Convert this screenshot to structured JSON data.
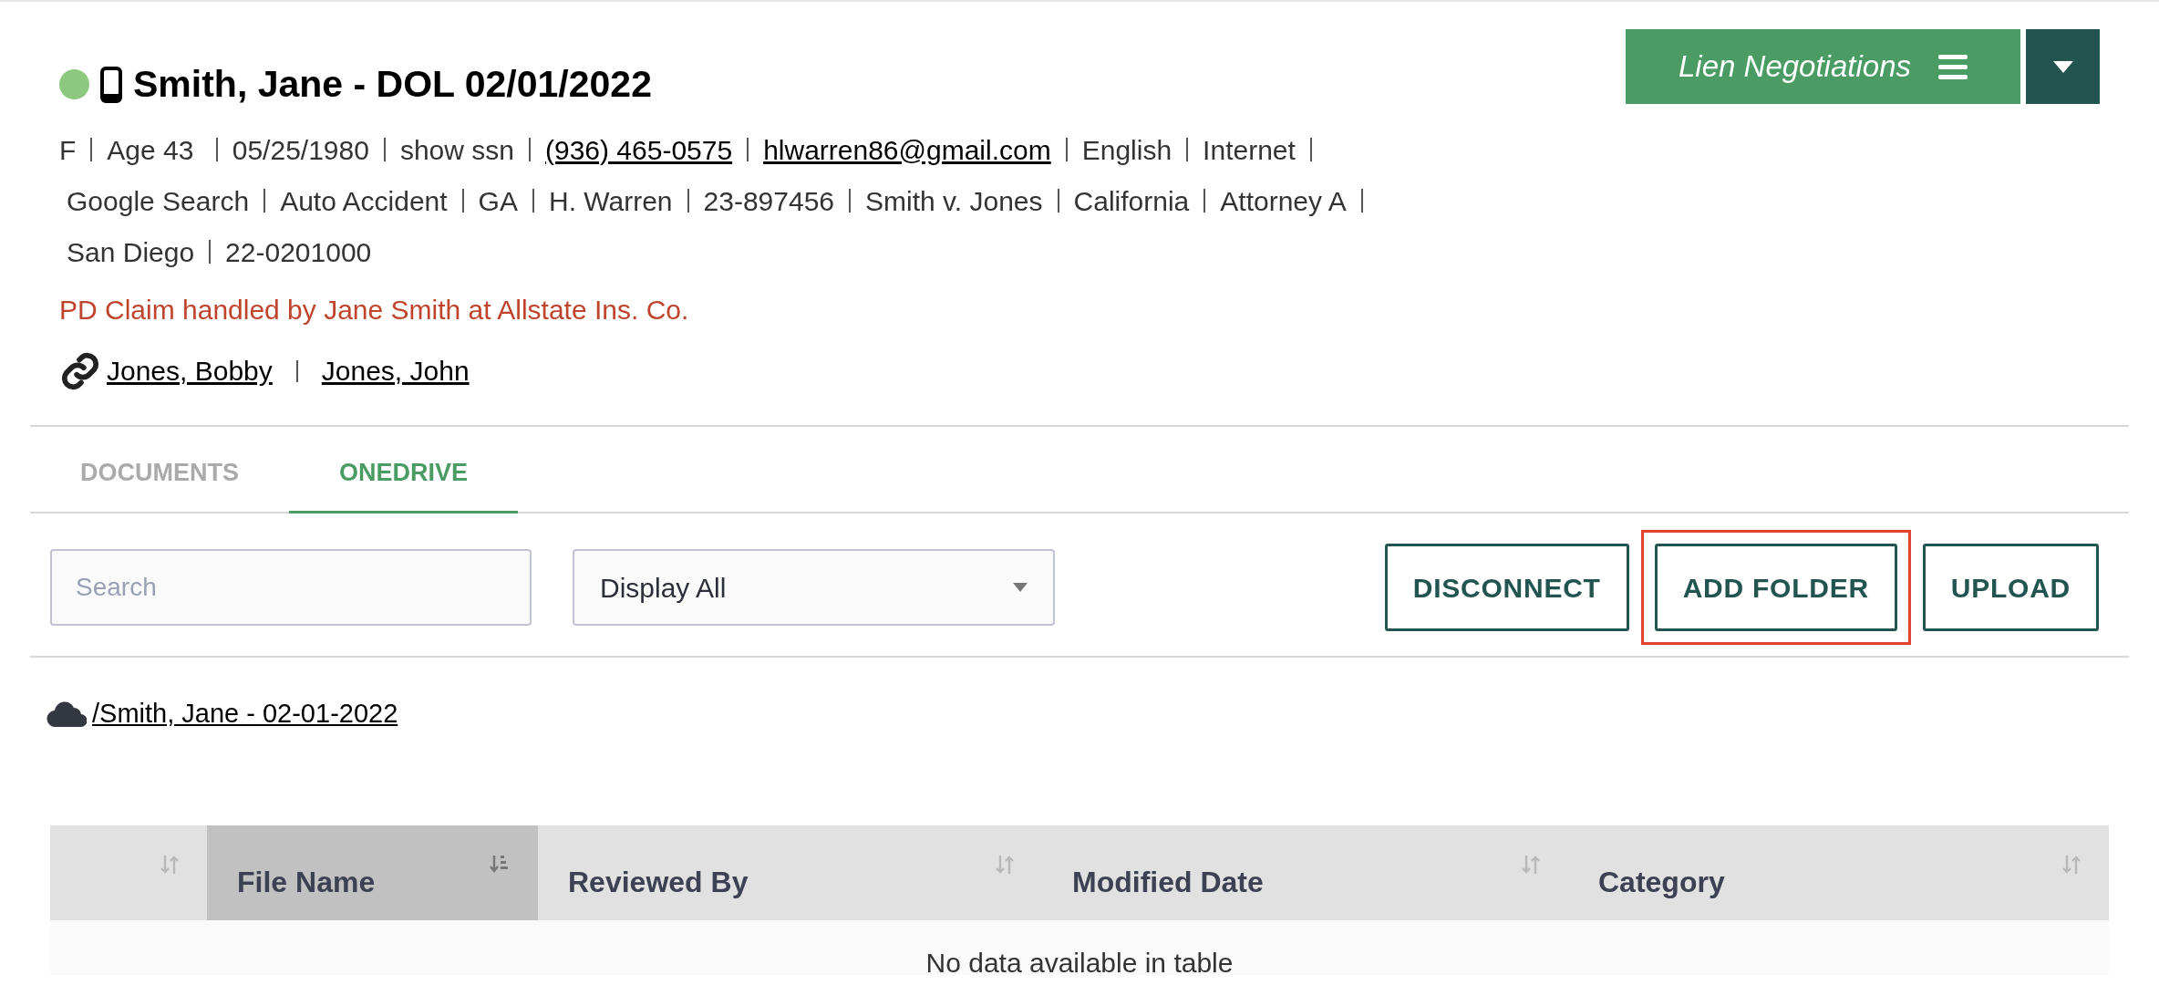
{
  "header": {
    "online": true,
    "title": "Smith, Jane - DOL 02/01/2022"
  },
  "stage_button": {
    "label": "Lien Negotiations"
  },
  "info_lines": [
    [
      {
        "text": "F",
        "kind": "text"
      },
      {
        "text": "Age 43 ",
        "kind": "text"
      },
      {
        "text": "05/25/1980",
        "kind": "text"
      },
      {
        "text": "show ssn",
        "kind": "text"
      },
      {
        "text": "(936) 465-0575",
        "kind": "link"
      },
      {
        "text": "hlwarren86@gmail.com",
        "kind": "link"
      },
      {
        "text": "English",
        "kind": "text"
      },
      {
        "text": "Internet",
        "kind": "text"
      }
    ],
    [
      {
        "text": "Google Search",
        "kind": "text"
      },
      {
        "text": "Auto Accident",
        "kind": "text"
      },
      {
        "text": "GA",
        "kind": "text"
      },
      {
        "text": "H. Warren",
        "kind": "text"
      },
      {
        "text": "23-897456",
        "kind": "text"
      },
      {
        "text": "Smith v. Jones",
        "kind": "text"
      },
      {
        "text": "California",
        "kind": "text"
      },
      {
        "text": "Attorney A",
        "kind": "text"
      }
    ],
    [
      {
        "text": "San Diego",
        "kind": "text"
      },
      {
        "text": "22-0201000",
        "kind": "text"
      }
    ]
  ],
  "alert": "PD Claim handled by Jane Smith at Allstate Ins. Co.",
  "related": [
    "Jones, Bobby",
    "Jones, John"
  ],
  "tabs": [
    {
      "label": "DOCUMENTS",
      "selected": false
    },
    {
      "label": "ONEDRIVE",
      "selected": true
    }
  ],
  "search": {
    "placeholder": "Search"
  },
  "filter": {
    "value": "Display All"
  },
  "actions": [
    {
      "label": "DISCONNECT",
      "highlighted": false
    },
    {
      "label": "ADD FOLDER",
      "highlighted": true
    },
    {
      "label": "UPLOAD",
      "highlighted": false
    }
  ],
  "breadcrumb": "/Smith, Jane - 02-01-2022",
  "table": {
    "columns": [
      {
        "selected": false
      },
      {
        "label": "File Name",
        "selected": true
      },
      {
        "label": "Reviewed By",
        "selected": false
      },
      {
        "label": "Modified Date",
        "selected": false
      },
      {
        "label": "Category",
        "selected": false
      }
    ],
    "empty_message": "No data available in table"
  }
}
